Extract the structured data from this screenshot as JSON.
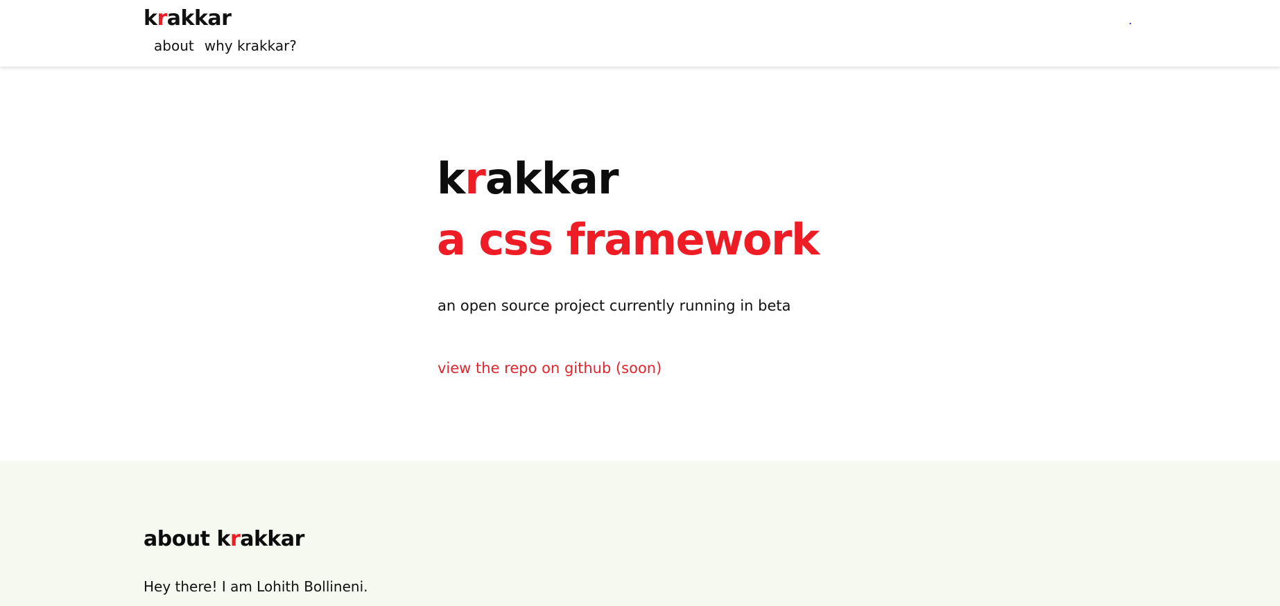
{
  "header": {
    "brand": {
      "prefix": "k",
      "accent": "r",
      "suffix": "akkar"
    },
    "nav": [
      {
        "label": "about"
      },
      {
        "label": "why krakkar?"
      }
    ]
  },
  "hero": {
    "title": {
      "prefix": "k",
      "accent": "r",
      "suffix": "akkar"
    },
    "subtitle": "a css framework",
    "description": "an open source project currently running in beta",
    "link_label": "view the repo on github (soon)"
  },
  "about": {
    "title": {
      "lead": "about ",
      "prefix": "k",
      "accent": "r",
      "suffix": "akkar"
    },
    "text": "Hey there! I am Lohith Bollineni."
  },
  "colors": {
    "accent": "#ee1c25",
    "about_background": "#f6f9ef",
    "text": "#111111"
  }
}
